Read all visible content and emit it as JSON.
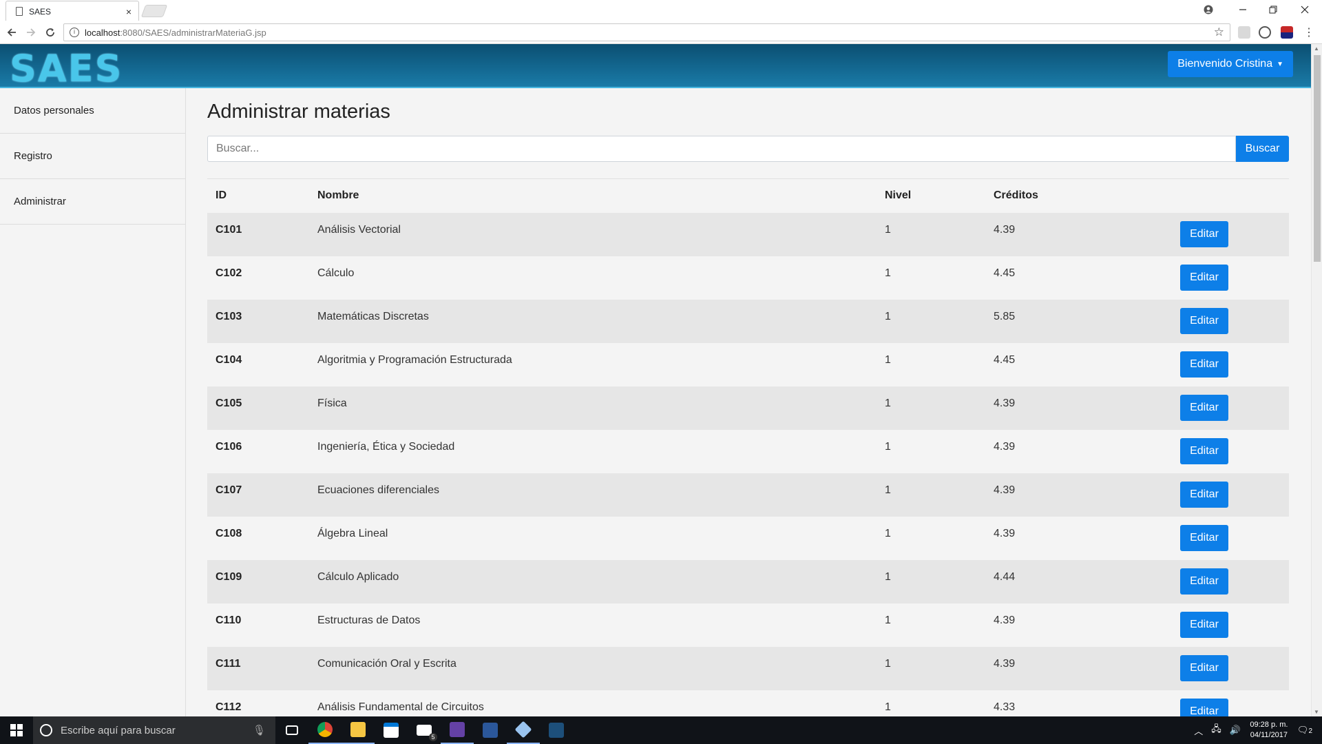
{
  "browser": {
    "tab_title": "SAES",
    "tab_close": "×",
    "url_host": "localhost",
    "url_path": ":8080/SAES/administrarMateriaG.jsp"
  },
  "header": {
    "logo": "SAES",
    "welcome_label": "Bienvenido Cristina"
  },
  "sidebar": {
    "items": [
      {
        "label": "Datos personales"
      },
      {
        "label": "Registro"
      },
      {
        "label": "Administrar"
      }
    ]
  },
  "main": {
    "title": "Administrar materias",
    "search_placeholder": "Buscar...",
    "search_button": "Buscar",
    "columns": [
      "ID",
      "Nombre",
      "Nivel",
      "Créditos"
    ],
    "edit_label": "Editar",
    "rows": [
      {
        "id": "C101",
        "name": "Análisis Vectorial",
        "level": "1",
        "credits": "4.39"
      },
      {
        "id": "C102",
        "name": "Cálculo",
        "level": "1",
        "credits": "4.45"
      },
      {
        "id": "C103",
        "name": "Matemáticas Discretas",
        "level": "1",
        "credits": "5.85"
      },
      {
        "id": "C104",
        "name": "Algoritmia y Programación Estructurada",
        "level": "1",
        "credits": "4.45"
      },
      {
        "id": "C105",
        "name": "Física",
        "level": "1",
        "credits": "4.39"
      },
      {
        "id": "C106",
        "name": "Ingeniería, Ética y Sociedad",
        "level": "1",
        "credits": "4.39"
      },
      {
        "id": "C107",
        "name": "Ecuaciones diferenciales",
        "level": "1",
        "credits": "4.39"
      },
      {
        "id": "C108",
        "name": "Álgebra Lineal",
        "level": "1",
        "credits": "4.39"
      },
      {
        "id": "C109",
        "name": "Cálculo Aplicado",
        "level": "1",
        "credits": "4.44"
      },
      {
        "id": "C110",
        "name": "Estructuras de Datos",
        "level": "1",
        "credits": "4.39"
      },
      {
        "id": "C111",
        "name": "Comunicación Oral y Escrita",
        "level": "1",
        "credits": "4.39"
      },
      {
        "id": "C112",
        "name": "Análisis Fundamental de Circuitos",
        "level": "1",
        "credits": "4.33"
      }
    ]
  },
  "taskbar": {
    "search_placeholder": "Escribe aquí para buscar",
    "mail_badge": "5",
    "time": "09:28 p. m.",
    "date": "04/11/2017",
    "notification_count": "2"
  },
  "colors": {
    "accent": "#0d7fe8",
    "header_dark": "#0b4f72",
    "header_light": "#1a7ba8",
    "logo": "#49c6ea"
  }
}
